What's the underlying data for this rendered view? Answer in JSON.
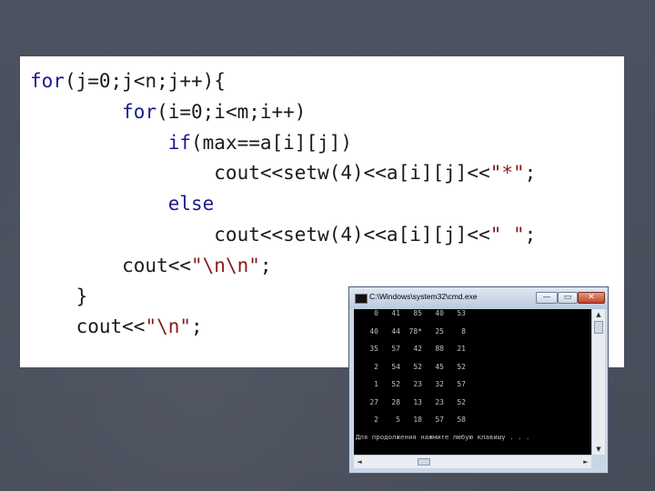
{
  "code": {
    "lines": [
      [
        {
          "t": "for",
          "c": "kw"
        },
        {
          "t": "(j=0;j<n;j++){",
          "c": "tx"
        }
      ],
      [
        {
          "t": "        ",
          "c": "tx"
        },
        {
          "t": "for",
          "c": "kw"
        },
        {
          "t": "(i=0;i<m;i++)",
          "c": "tx"
        }
      ],
      [
        {
          "t": "            ",
          "c": "tx"
        },
        {
          "t": "if",
          "c": "kw"
        },
        {
          "t": "(max==a[i][j])",
          "c": "tx"
        }
      ],
      [
        {
          "t": "                cout<<setw(4)<<a[i][j]<<",
          "c": "tx"
        },
        {
          "t": "\"*\"",
          "c": "st"
        },
        {
          "t": ";",
          "c": "tx"
        }
      ],
      [
        {
          "t": "            ",
          "c": "tx"
        },
        {
          "t": "else",
          "c": "kw"
        }
      ],
      [
        {
          "t": "                cout<<setw(4)<<a[i][j]<<",
          "c": "tx"
        },
        {
          "t": "\" \"",
          "c": "st"
        },
        {
          "t": ";",
          "c": "tx"
        }
      ],
      [
        {
          "t": "        cout<<",
          "c": "tx"
        },
        {
          "t": "\"\\n\\n\"",
          "c": "st"
        },
        {
          "t": ";",
          "c": "tx"
        }
      ],
      [
        {
          "t": "    }",
          "c": "tx"
        }
      ],
      [
        {
          "t": "    cout<<",
          "c": "tx"
        },
        {
          "t": "\"\\n\"",
          "c": "st"
        },
        {
          "t": ";",
          "c": "tx"
        }
      ]
    ]
  },
  "console_window": {
    "title": "C:\\Windows\\system32\\cmd.exe",
    "min_label": "—",
    "max_label": "▭",
    "close_label": "✕",
    "rows": [
      [
        "0",
        "41",
        "85",
        "40",
        "53"
      ],
      [
        "40",
        "44",
        "78*",
        "25",
        "8"
      ],
      [
        "35",
        "57",
        "42",
        "88",
        "21"
      ],
      [
        "2",
        "54",
        "52",
        "45",
        "52"
      ],
      [
        "1",
        "52",
        "23",
        "32",
        "57"
      ],
      [
        "27",
        "28",
        "13",
        "23",
        "52"
      ],
      [
        "2",
        "5",
        "18",
        "57",
        "58"
      ]
    ],
    "prompt": "Для продолжения нажмите любую клавишу . . .",
    "scroll_up": "▲",
    "scroll_down": "▼",
    "scroll_left": "◄",
    "scroll_right": "►"
  },
  "colors": {
    "keyword": "#1a1a8e",
    "text": "#1a1a1a",
    "string": "#8a1a1a",
    "background": "#4a4f5c"
  }
}
